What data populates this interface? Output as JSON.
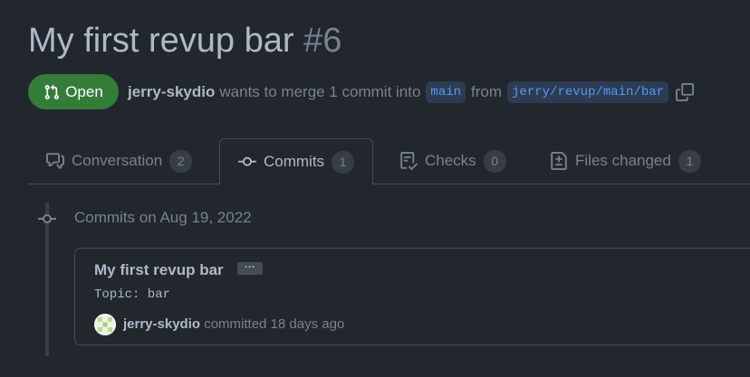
{
  "header": {
    "title": "My first revup bar",
    "number": "#6"
  },
  "state": {
    "label": "Open"
  },
  "meta": {
    "author": "jerry-skydio",
    "text_merge": "wants to merge 1 commit into",
    "base_branch": "main",
    "text_from": "from",
    "head_branch": "jerry/revup/main/bar"
  },
  "tabs": [
    {
      "label": "Conversation",
      "count": "2",
      "icon": "comment-discussion-icon"
    },
    {
      "label": "Commits",
      "count": "1",
      "icon": "git-commit-icon",
      "active": true
    },
    {
      "label": "Checks",
      "count": "0",
      "icon": "checklist-icon"
    },
    {
      "label": "Files changed",
      "count": "1",
      "icon": "file-diff-icon"
    }
  ],
  "commits": {
    "date_heading": "Commits on Aug 19, 2022",
    "items": [
      {
        "title": "My first revup bar",
        "ellipsis": "···",
        "body": "Topic: bar",
        "author": "jerry-skydio",
        "action": "committed 18 days ago"
      }
    ]
  },
  "colors": {
    "open_green": "#347d39",
    "link_blue": "#539bf5",
    "background": "#22272e"
  }
}
